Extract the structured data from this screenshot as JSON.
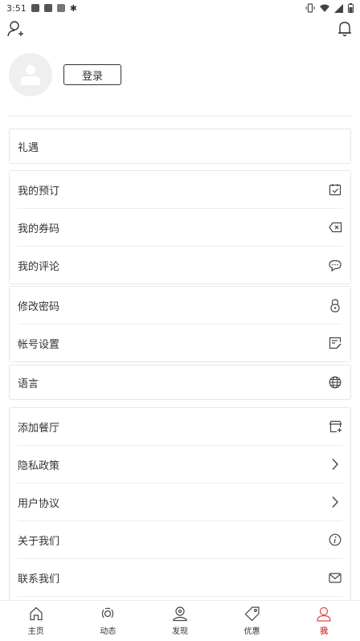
{
  "status_bar": {
    "time": "3:51"
  },
  "profile": {
    "login_label": "登录"
  },
  "cards": [
    {
      "items": [
        {
          "label": "礼遇",
          "icon": "none"
        }
      ]
    },
    {
      "items": [
        {
          "label": "我的预订",
          "icon": "calendar-check-icon"
        },
        {
          "label": "我的券码",
          "icon": "ticket-icon"
        },
        {
          "label": "我的评论",
          "icon": "comment-icon"
        }
      ]
    },
    {
      "items": [
        {
          "label": "修改密码",
          "icon": "lock-icon"
        },
        {
          "label": "帐号设置",
          "icon": "edit-icon"
        }
      ]
    },
    {
      "items": [
        {
          "label": "语言",
          "icon": "globe-icon"
        }
      ]
    },
    {
      "items": [
        {
          "label": "添加餐厅",
          "icon": "add-shop-icon"
        },
        {
          "label": "隐私政策",
          "icon": "chevron-right-icon"
        },
        {
          "label": "用户协议",
          "icon": "chevron-right-icon"
        },
        {
          "label": "关于我们",
          "icon": "info-icon"
        },
        {
          "label": "联系我们",
          "icon": "mail-icon"
        }
      ]
    }
  ],
  "tabbar": {
    "items": [
      {
        "label": "主页",
        "icon": "home-icon"
      },
      {
        "label": "动态",
        "icon": "feed-icon"
      },
      {
        "label": "发现",
        "icon": "discover-icon"
      },
      {
        "label": "优惠",
        "icon": "tag-icon"
      },
      {
        "label": "我",
        "icon": "user-icon",
        "active": true
      }
    ]
  },
  "colors": {
    "accent": "#e24a4a",
    "border": "#e6e6e6"
  }
}
